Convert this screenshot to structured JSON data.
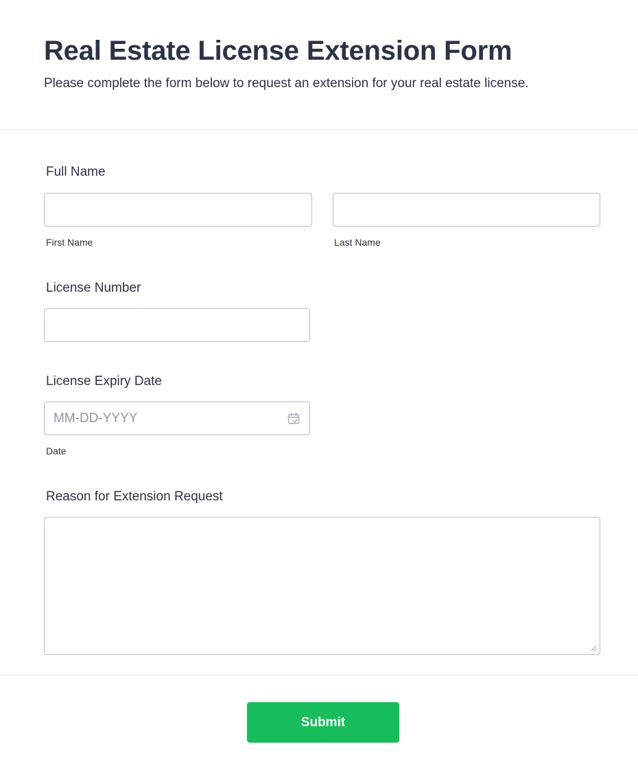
{
  "form": {
    "title": "Real Estate License Extension Form",
    "subtitle": "Please complete the form below to request an extension for your real estate license."
  },
  "fields": {
    "full_name": {
      "label": "Full Name",
      "first_sublabel": "First Name",
      "last_sublabel": "Last Name",
      "first_value": "",
      "last_value": ""
    },
    "license_number": {
      "label": "License Number",
      "value": ""
    },
    "license_expiry": {
      "label": "License Expiry Date",
      "placeholder": "MM-DD-YYYY",
      "sublabel": "Date",
      "icon": "calendar-icon"
    },
    "reason": {
      "label": "Reason for Extension Request",
      "value": ""
    }
  },
  "submit": {
    "label": "Submit",
    "color": "#18bd5b"
  }
}
